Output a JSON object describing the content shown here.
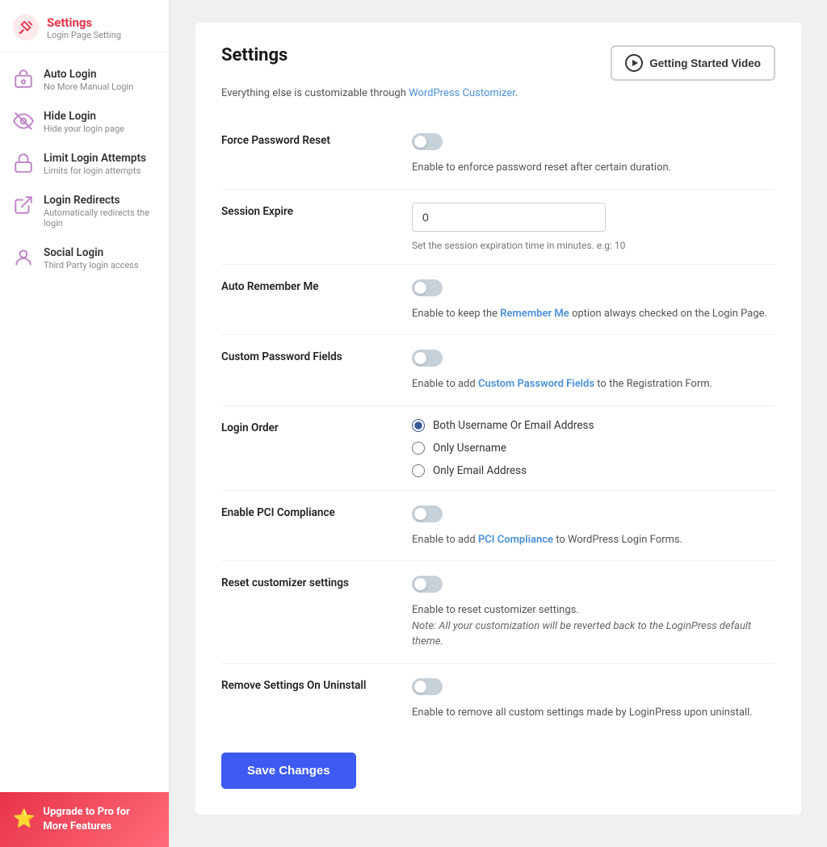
{
  "sidebar": {
    "header": {
      "title": "Settings",
      "subtitle": "Login Page Setting"
    },
    "items": [
      {
        "id": "auto-login",
        "label": "Auto Login",
        "sublabel": "No More Manual Login"
      },
      {
        "id": "hide-login",
        "label": "Hide Login",
        "sublabel": "Hide your login page"
      },
      {
        "id": "limit-login",
        "label": "Limit Login Attempts",
        "sublabel": "Limits for login attempts"
      },
      {
        "id": "login-redirects",
        "label": "Login Redirects",
        "sublabel": "Automatically redirects the login"
      },
      {
        "id": "social-login",
        "label": "Social Login",
        "sublabel": "Third Party login access"
      }
    ],
    "upgrade": {
      "label": "Upgrade to Pro for More Features"
    }
  },
  "main": {
    "page_title": "Settings",
    "page_desc_prefix": "Everything else is customizable through ",
    "page_desc_link": "WordPress Customizer",
    "page_desc_suffix": ".",
    "getting_started_btn": "Getting Started Video",
    "rows": [
      {
        "id": "force-password",
        "label": "Force Password Reset",
        "desc": "Enable to enforce password reset after certain duration.",
        "type": "toggle",
        "checked": false
      },
      {
        "id": "session-expire",
        "label": "Session Expire",
        "type": "input",
        "value": "0",
        "hint": "Set the session expiration time in minutes. e.g: 10"
      },
      {
        "id": "auto-remember",
        "label": "Auto Remember Me",
        "type": "toggle",
        "checked": false,
        "desc_prefix": "Enable to keep the ",
        "desc_link": "Remember Me",
        "desc_suffix": " option always checked on the Login Page."
      },
      {
        "id": "custom-password",
        "label": "Custom Password Fields",
        "type": "toggle",
        "checked": false,
        "desc_prefix": "Enable to add ",
        "desc_link": "Custom Password Fields",
        "desc_suffix": " to the Registration Form."
      },
      {
        "id": "login-order",
        "label": "Login Order",
        "type": "radio",
        "options": [
          {
            "value": "both",
            "label": "Both Username Or Email Address",
            "checked": true
          },
          {
            "value": "username",
            "label": "Only Username",
            "checked": false
          },
          {
            "value": "email",
            "label": "Only Email Address",
            "checked": false
          }
        ]
      },
      {
        "id": "pci-compliance",
        "label": "Enable PCI Compliance",
        "type": "toggle",
        "checked": false,
        "desc_prefix": "Enable to add ",
        "desc_link": "PCI Compliance",
        "desc_suffix": " to WordPress Login Forms."
      },
      {
        "id": "reset-customizer",
        "label": "Reset customizer settings",
        "type": "toggle",
        "checked": false,
        "desc": "Enable to reset customizer settings.",
        "desc_note": "Note: All your customization will be reverted back to the LoginPress default theme."
      },
      {
        "id": "remove-settings",
        "label": "Remove Settings On Uninstall",
        "type": "toggle",
        "checked": false,
        "desc": "Enable to remove all custom settings made by LoginPress upon uninstall."
      }
    ],
    "save_btn": "Save Changes"
  }
}
